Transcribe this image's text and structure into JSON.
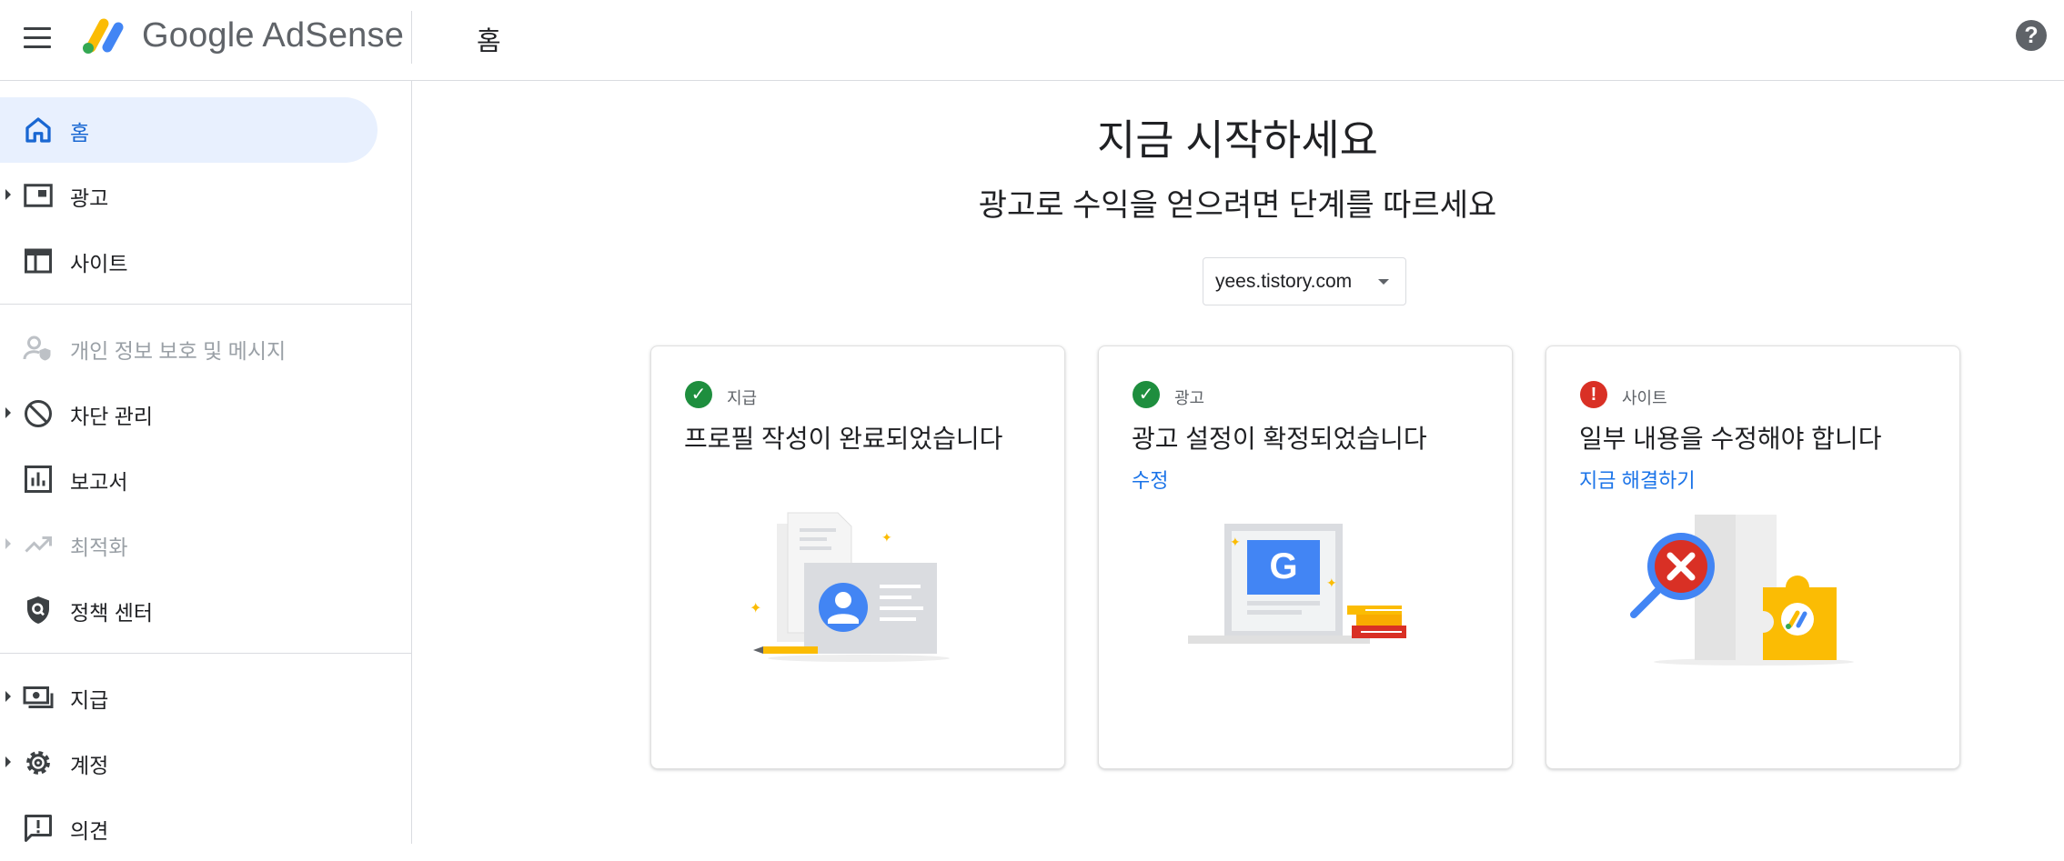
{
  "app": {
    "name": "Google AdSense",
    "page_title": "홈"
  },
  "sidebar": {
    "items": [
      {
        "label": "홈",
        "icon": "home-icon",
        "active": true
      },
      {
        "label": "광고",
        "icon": "ads-icon",
        "expandable": true
      },
      {
        "label": "사이트",
        "icon": "sites-icon"
      },
      {
        "label": "개인 정보 보호 및 메시지",
        "icon": "privacy-person-icon",
        "disabled": true
      },
      {
        "label": "차단 관리",
        "icon": "block-icon",
        "expandable": true
      },
      {
        "label": "보고서",
        "icon": "report-chart-icon"
      },
      {
        "label": "최적화",
        "icon": "trending-up-icon",
        "expandable": true,
        "disabled": true
      },
      {
        "label": "정책 센터",
        "icon": "policy-shield-icon"
      },
      {
        "label": "지급",
        "icon": "payments-icon",
        "expandable": true
      },
      {
        "label": "계정",
        "icon": "settings-gear-icon",
        "expandable": true
      },
      {
        "label": "의견",
        "icon": "feedback-icon"
      }
    ]
  },
  "main": {
    "heading": "지금 시작하세요",
    "subheading": "광고로 수익을 얻으려면 단계를 따르세요",
    "site_selector": {
      "value": "yees.tistory.com"
    },
    "cards": [
      {
        "category": "지급",
        "title": "프로필 작성이 완료되었습니다",
        "status": "complete",
        "link": ""
      },
      {
        "category": "광고",
        "title": "광고 설정이 확정되었습니다",
        "status": "complete",
        "link": "수정"
      },
      {
        "category": "사이트",
        "title": "일부 내용을 수정해야 합니다",
        "status": "error",
        "link": "지금 해결하기"
      }
    ]
  },
  "colors": {
    "accent": "#1a73e8",
    "active_bg": "#e8f0fe",
    "success": "#1e8e3e",
    "error": "#d93025",
    "warning": "#fbbc04"
  }
}
